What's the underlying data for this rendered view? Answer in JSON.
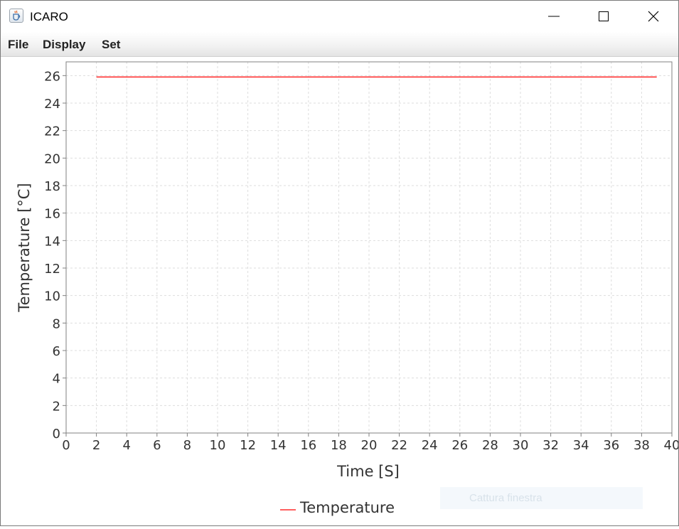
{
  "window": {
    "title": "ICARO"
  },
  "menu": {
    "items": [
      "File",
      "Display",
      "Set"
    ]
  },
  "chart_data": {
    "type": "line",
    "xlabel": "Time [S]",
    "ylabel": "Temperature [°C]",
    "xlim": [
      0,
      40
    ],
    "ylim": [
      0,
      27
    ],
    "xticks": [
      0,
      2,
      4,
      6,
      8,
      10,
      12,
      14,
      16,
      18,
      20,
      22,
      24,
      26,
      28,
      30,
      32,
      34,
      36,
      38,
      40
    ],
    "yticks": [
      0,
      2,
      4,
      6,
      8,
      10,
      12,
      14,
      16,
      18,
      20,
      22,
      24,
      26
    ],
    "grid": true,
    "legend": "bottom-center",
    "series": [
      {
        "name": "Temperature",
        "color": "#ff0000",
        "x": [
          2,
          3,
          4,
          5,
          6,
          7,
          8,
          9,
          10,
          11,
          12,
          13,
          14,
          15,
          16,
          17,
          18,
          19,
          20,
          21,
          22,
          23,
          24,
          25,
          26,
          27,
          28,
          29,
          30,
          31,
          32,
          33,
          34,
          35,
          36,
          37,
          38,
          39
        ],
        "y": [
          25.9,
          25.9,
          25.9,
          25.9,
          25.9,
          25.9,
          25.9,
          25.9,
          25.9,
          25.9,
          25.9,
          25.9,
          25.9,
          25.9,
          25.9,
          25.9,
          25.9,
          25.9,
          25.9,
          25.9,
          25.9,
          25.9,
          25.9,
          25.9,
          25.9,
          25.9,
          25.9,
          25.9,
          25.9,
          25.9,
          25.9,
          25.9,
          25.9,
          25.9,
          25.9,
          25.9,
          25.9,
          25.9
        ]
      }
    ]
  },
  "overlay": {
    "text": "Cattura finestra"
  },
  "icons": {
    "app": "java-cup-icon",
    "minimize": "minimize-icon",
    "maximize": "maximize-icon",
    "close": "close-icon"
  }
}
